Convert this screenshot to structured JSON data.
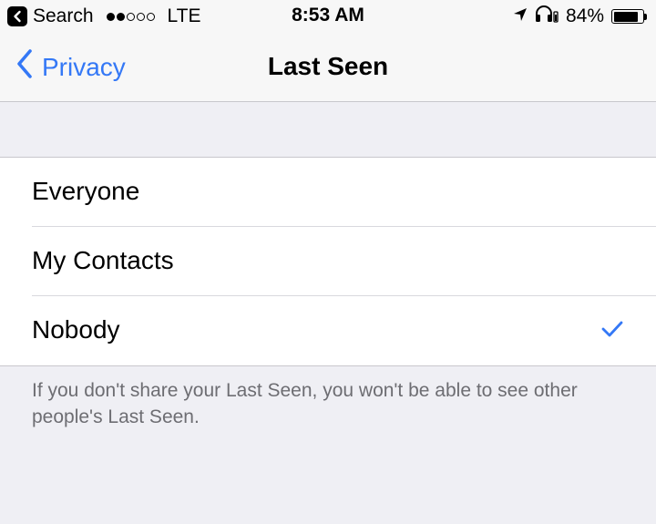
{
  "status_bar": {
    "back_app_label": "Search",
    "signal_dots": [
      true,
      true,
      false,
      false,
      false
    ],
    "carrier": "LTE",
    "time": "8:53 AM",
    "battery_percent_text": "84%",
    "battery_level": 0.84
  },
  "nav": {
    "back_label": "Privacy",
    "title": "Last Seen",
    "accent_color": "#3478f6"
  },
  "options": [
    {
      "label": "Everyone",
      "selected": false
    },
    {
      "label": "My Contacts",
      "selected": false
    },
    {
      "label": "Nobody",
      "selected": true
    }
  ],
  "footer_note": "If you don't share your Last Seen, you won't be able to see other people's Last Seen.",
  "icons": {
    "back_app": "chevron-left-icon",
    "location": "location-arrow-icon",
    "headphones": "headphones-icon",
    "battery": "battery-icon",
    "nav_back": "chevron-left-icon",
    "check": "checkmark-icon"
  }
}
